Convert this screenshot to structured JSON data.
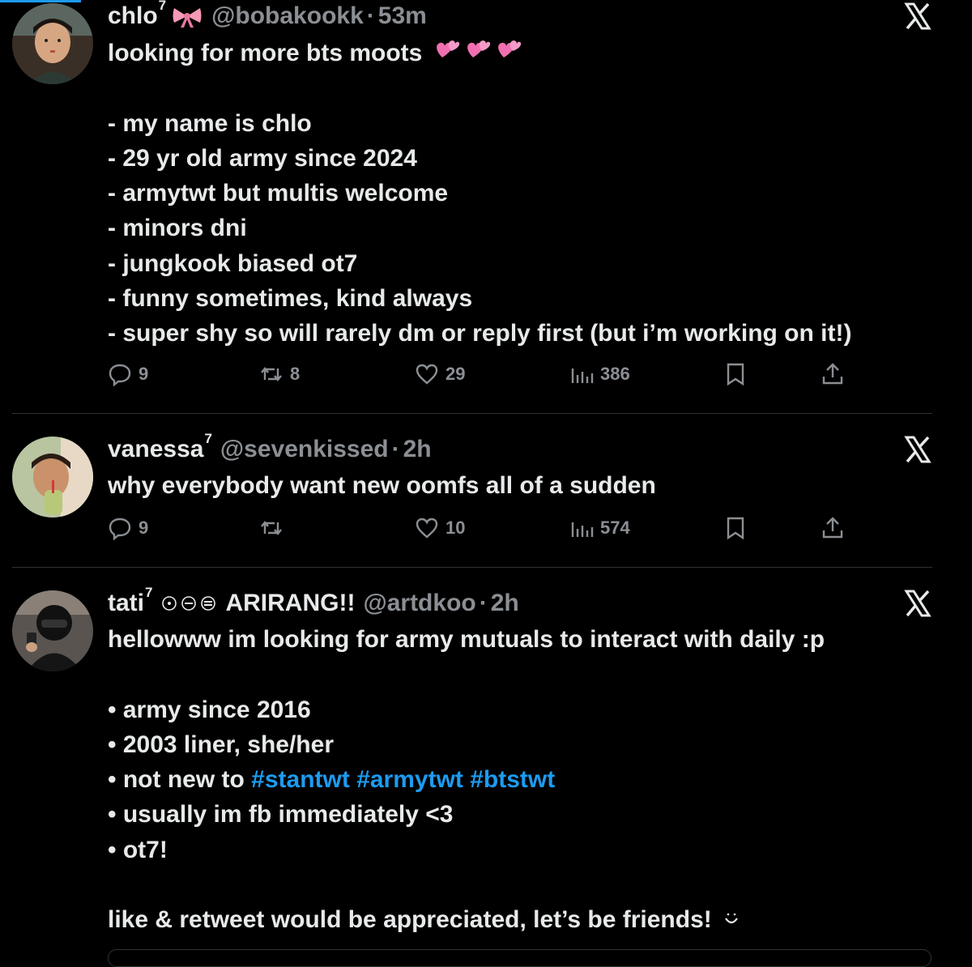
{
  "colors": {
    "background": "#000000",
    "text": "#e7e9ea",
    "muted": "#8b8f94",
    "link": "#1d9bf0",
    "divider": "#2f3336"
  },
  "tweets": [
    {
      "display_name": "chlo",
      "name_sup": "7",
      "name_icon": "pink-ribbon-icon",
      "handle": "@bobakookk",
      "separator": "·",
      "time": "53m",
      "first_line": "looking for more bts moots",
      "first_line_icons": [
        "pink-hearts-icon",
        "pink-hearts-icon",
        "pink-hearts-icon"
      ],
      "lines": [
        "- my name is chlo",
        "- 29 yr old army since 2024",
        "- armytwt but multis welcome",
        "- minors dni",
        "- jungkook biased ot7",
        "- funny sometimes, kind always",
        "- super shy so will rarely dm or reply first (but i’m working on it!)"
      ],
      "replies": "9",
      "retweets": "8",
      "likes": "29",
      "views": "386"
    },
    {
      "display_name": "vanessa",
      "name_sup": "7",
      "handle": "@sevenkissed",
      "separator": "·",
      "time": "2h",
      "first_line": "why everybody want new oomfs all of a sudden",
      "replies": "9",
      "retweets": "",
      "likes": "10",
      "views": "574"
    },
    {
      "display_name": "tati",
      "name_sup": "7",
      "name_icons": [
        "circle-dot-icon",
        "circle-minus-icon",
        "circle-equal-icon"
      ],
      "name_suffix": "ARIRANG!!",
      "handle": "@artdkoo",
      "separator": "·",
      "time": "2h",
      "first_line": "hellowww im looking for army mutuals to interact with daily :p",
      "bullets": [
        "• army since 2016",
        "• 2003 liner, she/her",
        "•  not new to",
        "• usually im fb immediately <3",
        "• ot7!"
      ],
      "hashtags": [
        "#stantwt",
        "#armytwt",
        "#btstwt"
      ],
      "closing": "like & retweet would be appreciated, let’s be friends!",
      "closing_icon": "smile-icon"
    }
  ]
}
